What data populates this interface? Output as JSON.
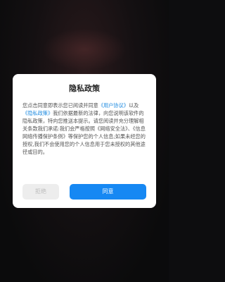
{
  "dialog": {
    "title": "隐私政策",
    "body": {
      "part1": "您点击同意即表示您已阅读并同意",
      "user_agreement_link": "《用户协议》",
      "part2": "以及",
      "privacy_policy_link": "《隐私政策》",
      "part3": "我们依据最新的法律，向您说明该软件的隐私政策，特向您推送本提示。请您阅读并充分理解相关条款我们承诺:我们会严格按照《网络安全法》、《信息网络传播保护条例》等保护您的个人信息;如果未经您的授权,我们不会使用您的个人信息用于您未授权的其他途径或目的。"
    },
    "buttons": {
      "reject": "拒绝",
      "agree": "同意"
    }
  },
  "colors": {
    "accent": "#1688f3",
    "link": "#1f8be0",
    "reject_bg": "#ededed",
    "reject_text": "#bdbdbd",
    "overlay": "#0d0d0f"
  }
}
